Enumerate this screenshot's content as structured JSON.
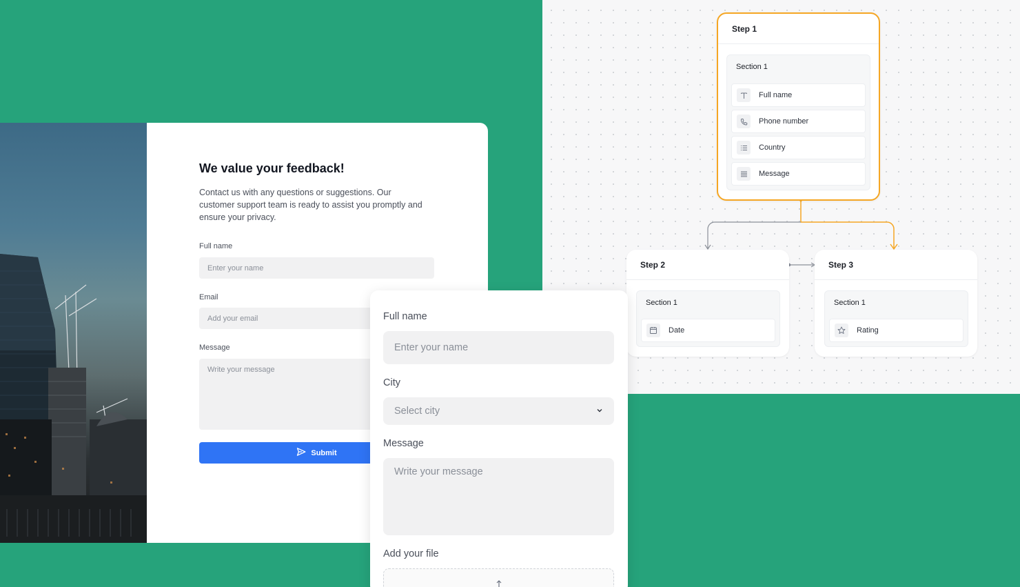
{
  "feedback": {
    "title": "We value your feedback!",
    "description": "Contact us with any questions or suggestions. Our customer support team is ready to assist you promptly and ensure your privacy.",
    "full_name_label": "Full name",
    "full_name_placeholder": "Enter your name",
    "email_label": "Email",
    "email_placeholder": "Add your email",
    "message_label": "Message",
    "message_placeholder": "Write your message",
    "submit_label": "Submit"
  },
  "overlay_form": {
    "full_name_label": "Full name",
    "full_name_placeholder": "Enter your name",
    "city_label": "City",
    "city_placeholder": "Select city",
    "message_label": "Message",
    "message_placeholder": "Write your message",
    "file_label": "Add your file"
  },
  "flow": {
    "step1": {
      "title": "Step 1",
      "section": "Section 1",
      "fields": [
        {
          "label": "Full name",
          "icon": "text-icon"
        },
        {
          "label": "Phone number",
          "icon": "phone-icon"
        },
        {
          "label": "Country",
          "icon": "list-icon"
        },
        {
          "label": "Message",
          "icon": "paragraph-icon"
        }
      ]
    },
    "step2": {
      "title": "Step 2",
      "section": "Section 1",
      "fields": [
        {
          "label": "Date",
          "icon": "calendar-icon"
        }
      ]
    },
    "step3": {
      "title": "Step 3",
      "section": "Section 1",
      "fields": [
        {
          "label": "Rating",
          "icon": "star-icon"
        }
      ]
    }
  },
  "colors": {
    "background": "#26a37b",
    "accent": "#2f74f5",
    "active_step": "#f5a623"
  }
}
